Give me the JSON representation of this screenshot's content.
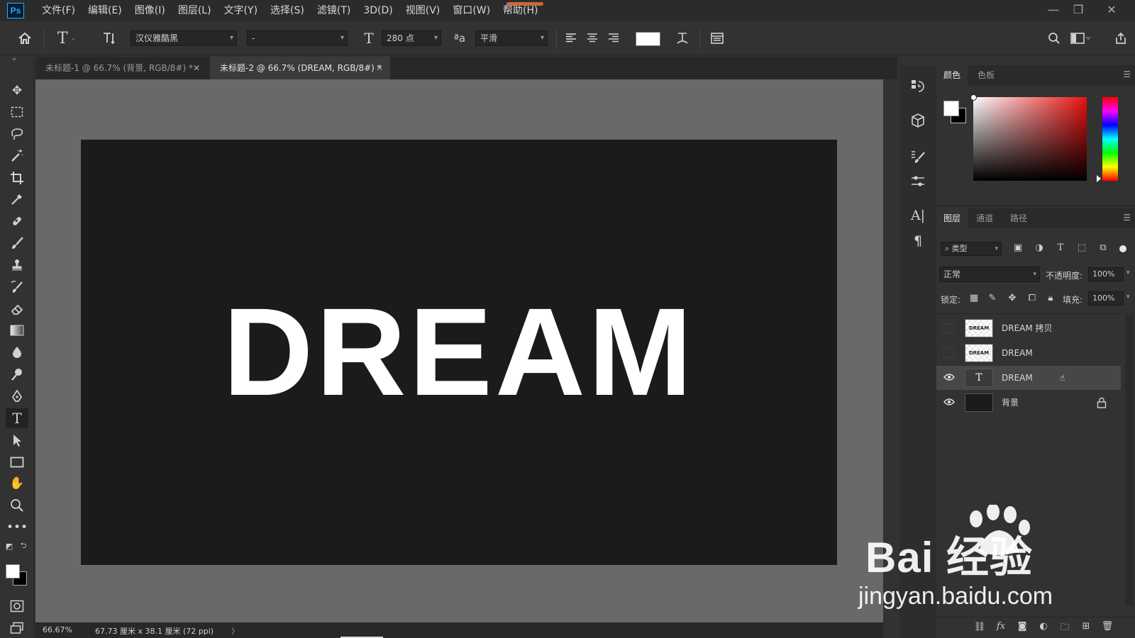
{
  "app": {
    "logo": "Ps",
    "menus": [
      "文件(F)",
      "编辑(E)",
      "图像(I)",
      "图层(L)",
      "文字(Y)",
      "选择(S)",
      "滤镜(T)",
      "3D(D)",
      "视图(V)",
      "窗口(W)",
      "帮助(H)"
    ]
  },
  "options": {
    "font_family": "汉仪雅酷黑",
    "font_style": "-",
    "font_size": "280 点",
    "aa_label": "ªa",
    "antialias": "平滑",
    "text_color": "#ffffff"
  },
  "tabs": [
    {
      "label": "未标题-1 @ 66.7% (背景, RGB/8#) *",
      "active": false
    },
    {
      "label": "未标题-2 @ 66.7% (DREAM, RGB/8#) *",
      "active": true
    }
  ],
  "canvas": {
    "text": "DREAM",
    "background": "#1b1b1b"
  },
  "status": {
    "zoom": "66.67%",
    "doc_size": "67.73 厘米 x 38.1 厘米 (72 ppi)",
    "arrow": "〉"
  },
  "color_panel": {
    "tabs": [
      "颜色",
      "色板"
    ]
  },
  "layers_panel": {
    "tabs": [
      "图层",
      "通道",
      "路径"
    ],
    "filter_label": "类型",
    "blend_mode": "正常",
    "opacity_label": "不透明度:",
    "opacity_value": "100%",
    "lock_label": "锁定:",
    "fill_label": "填充:",
    "fill_value": "100%",
    "layers": [
      {
        "name": "DREAM 拷贝",
        "visible": false,
        "thumb": "checker",
        "thumb_text": "DREAM"
      },
      {
        "name": "DREAM",
        "visible": false,
        "thumb": "checker",
        "thumb_text": "DREAM"
      },
      {
        "name": "DREAM",
        "visible": true,
        "thumb": "type",
        "thumb_text": "T",
        "active": true
      },
      {
        "name": "背景",
        "visible": true,
        "thumb": "dark",
        "locked": true
      }
    ],
    "footer_icons": [
      "link-icon",
      "fx-icon",
      "mask-icon",
      "adjustment-icon",
      "group-icon",
      "new-layer-icon",
      "trash-icon"
    ]
  },
  "watermark": {
    "logo": "Bai  经验",
    "url": "jingyan.baidu.com"
  }
}
